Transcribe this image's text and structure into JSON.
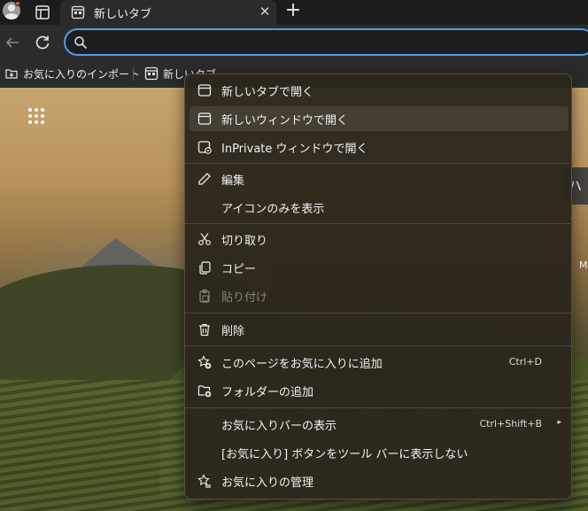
{
  "tab": {
    "title": "新しいタブ",
    "close": "✕"
  },
  "new_tab": "+",
  "address_bar": {
    "value": "",
    "placeholder": ""
  },
  "favorites_bar": {
    "items": [
      {
        "label": "お気に入りのインポート"
      },
      {
        "label": "新しいタブ"
      }
    ]
  },
  "background": {
    "partial_text_right": "ハ",
    "partial_m": "M"
  },
  "menu": {
    "open_new_tab": "新しいタブで開く",
    "open_new_window": "新しいウィンドウで開く",
    "open_inprivate": "InPrivate ウィンドウで開く",
    "edit": "編集",
    "show_icons_only": "アイコンのみを表示",
    "cut": "切り取り",
    "copy": "コピー",
    "paste": "貼り付け",
    "delete": "削除",
    "add_page": {
      "label": "このページをお気に入りに追加",
      "shortcut": "Ctrl+D"
    },
    "add_folder": "フォルダーの追加",
    "show_favorites_bar": {
      "label": "お気に入りバーの表示",
      "shortcut": "Ctrl+Shift+B",
      "arrow": "▸"
    },
    "hide_favorites_button": "[お気に入り] ボタンをツール バーに表示しない",
    "manage_favorites": "お気に入りの管理"
  },
  "colors": {
    "accent": "#4c9ee8",
    "menu_bg": "#2c261c",
    "profile_badge": "#e34a4a"
  }
}
